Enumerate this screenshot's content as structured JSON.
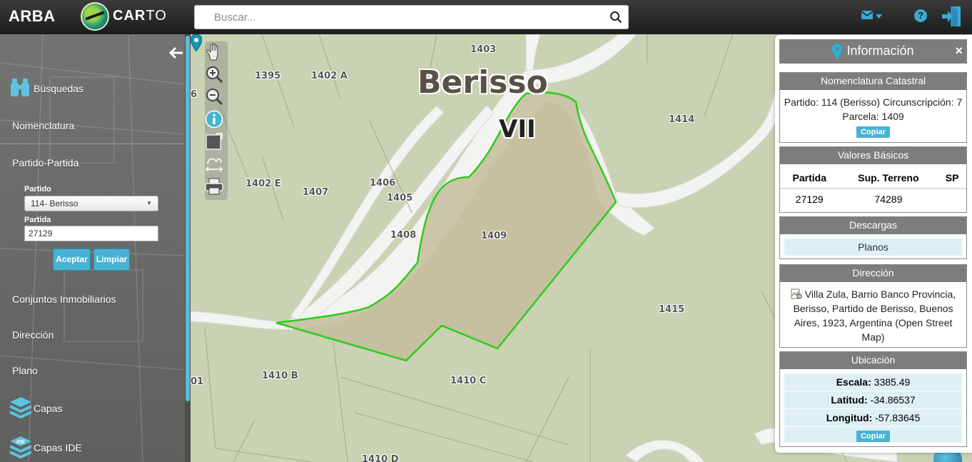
{
  "header": {
    "brand": "ARBA",
    "logo_main": "CAR",
    "logo_tail": "TO",
    "search_placeholder": "Buscar...",
    "icons": [
      "search-icon",
      "mail-icon",
      "help-icon",
      "logout-icon"
    ],
    "help_glyph": "?"
  },
  "sidebar": {
    "busquedas": "Búsquedas",
    "nomenclatura": "Nomenclatura",
    "partido_partida": "Partido-Partida",
    "partido_label": "Partido",
    "partido_value": "114- Berisso",
    "partida_label": "Partida",
    "partida_value": "27129",
    "aceptar": "Aceptar",
    "limpiar": "Limpiar",
    "conjuntos": "Conjuntos Inmobiliarios",
    "direccion": "Dirección",
    "plano": "Plano",
    "capas": "Capas",
    "capas_ide": "Capas IDE",
    "ide_badge": "IDE"
  },
  "map": {
    "town": "Berisso",
    "circunscripcion": "VII",
    "labels": [
      "1403",
      "1395",
      "1402 A",
      "6",
      "1414",
      "1402 E",
      "1407",
      "1406",
      "1405",
      "1408",
      "1409",
      "1415",
      "1410 B",
      "1410 C",
      "01",
      "1410 D"
    ],
    "selection_color": "#2ecc1a",
    "tools": [
      "pan-hand-icon",
      "zoom-in-icon",
      "zoom-out-icon",
      "info-icon",
      "zoom-box-icon",
      "measure-icon",
      "print-icon"
    ]
  },
  "info": {
    "title": "Información",
    "close": "×",
    "nomenclatura": {
      "head": "Nomenclatura Catastral",
      "line1": "Partido: 114 (Berisso) Circunscripción: 7",
      "line2": "Parcela: 1409",
      "copy": "Copiar"
    },
    "valores": {
      "head": "Valores Básicos",
      "cols": [
        "Partida",
        "Sup. Terreno",
        "SP"
      ],
      "row": [
        "27129",
        "74289",
        ""
      ]
    },
    "descargas": {
      "head": "Descargas",
      "planos": "Planos"
    },
    "direccion": {
      "head": "Dirección",
      "text": "Villa Zula, Barrio Banco Provincia, Berisso, Partido de Berisso, Buenos Aires, 1923, Argentina (Open Street Map)"
    },
    "ubicacion": {
      "head": "Ubicación",
      "escala_label": "Escala:",
      "escala": "3385.49",
      "latitud_label": "Latitud:",
      "latitud": "-34.86537",
      "longitud_label": "Longitud:",
      "longitud": "-57.83645",
      "copy": "Copiar"
    }
  }
}
